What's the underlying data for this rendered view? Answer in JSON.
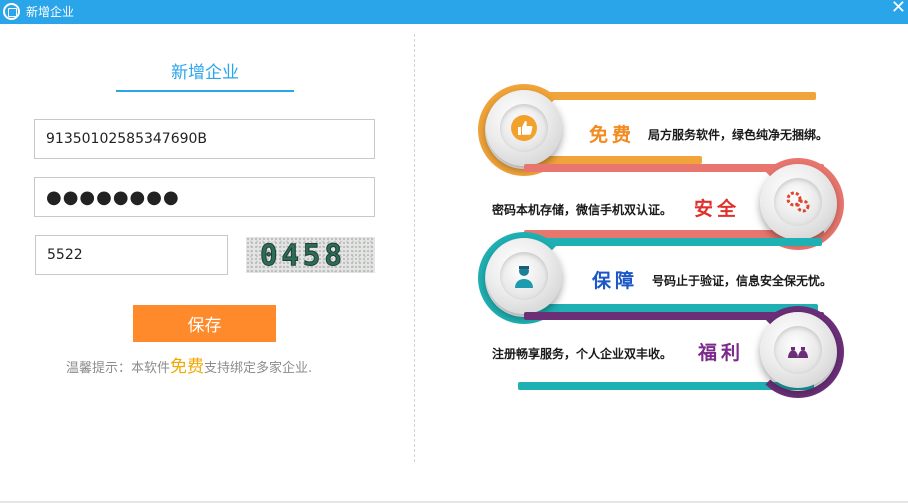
{
  "window": {
    "title": "新增企业",
    "close_glyph": "✕"
  },
  "form": {
    "heading": "新增企业",
    "credit_code_value": "91350102585347690B",
    "password_value": "●●●●●●●●",
    "captcha_value": "5522",
    "captcha_image_text": "0458",
    "save_label": "保存",
    "tip_prefix": "温馨提示：本软件",
    "tip_highlight": "免费",
    "tip_suffix": "支持绑定多家企业."
  },
  "features": [
    {
      "title": "免费",
      "description": "局方服务软件，绿色纯净无捆绑。",
      "color": "#f28a1e",
      "icon": "thumbs-up-icon"
    },
    {
      "title": "安全",
      "description": "密码本机存储，微信手机双认证。",
      "color": "#e0302b",
      "icon": "gears-icon"
    },
    {
      "title": "保障",
      "description": "号码止于验证，信息安全保无忧。",
      "color": "#1b57c6",
      "icon": "support-agent-icon"
    },
    {
      "title": "福利",
      "description": "注册畅享服务，个人企业双丰收。",
      "color": "#7b2a8c",
      "icon": "money-bags-icon"
    }
  ],
  "colors": {
    "titlebar": "#2aa5ea",
    "accent": "#2aa5ea",
    "button": "#ff8a2b",
    "ring_1": "#f0a43a",
    "ring_2": "#e8766e",
    "ring_3": "#1fb0b3",
    "ring_4": "#6b2f78"
  }
}
